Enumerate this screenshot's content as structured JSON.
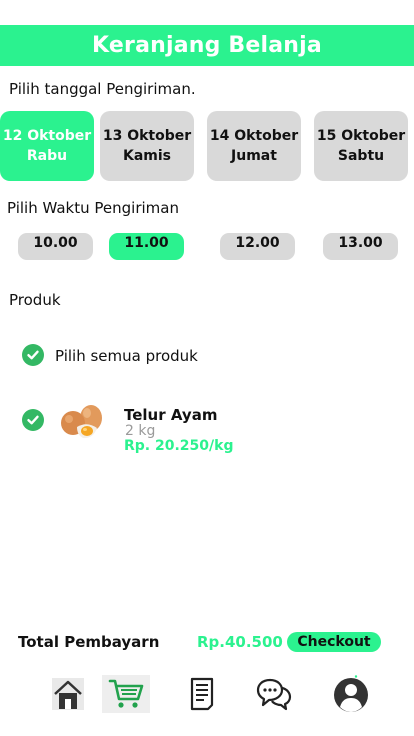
{
  "header": {
    "title": "Keranjang Belanja"
  },
  "date_section": {
    "label": "Pilih tanggal Pengiriman.",
    "dates": [
      {
        "day": "12 Oktober",
        "weekday": "Rabu",
        "selected": true
      },
      {
        "day": "13 Oktober",
        "weekday": "Kamis",
        "selected": false
      },
      {
        "day": "14 Oktober",
        "weekday": "Jumat",
        "selected": false
      },
      {
        "day": "15 Oktober",
        "weekday": "Sabtu",
        "selected": false
      }
    ]
  },
  "time_section": {
    "label": "Pilih Waktu Pengiriman",
    "times": [
      {
        "value": "10.00",
        "selected": false
      },
      {
        "value": "11.00",
        "selected": true
      },
      {
        "value": "12.00",
        "selected": false
      },
      {
        "value": "13.00",
        "selected": false
      }
    ]
  },
  "product_section": {
    "label": "Produk",
    "select_all_label": "Pilih semua produk",
    "items": [
      {
        "name": "Telur Ayam",
        "weight": "2 kg",
        "price": "Rp. 20.250/kg",
        "checked": true
      }
    ]
  },
  "summary": {
    "total_label": "Total Pembayarn",
    "total_value": "Rp.40.500",
    "checkout_label": "Checkout"
  },
  "bottom_nav": [
    {
      "icon": "home-icon",
      "active": false
    },
    {
      "icon": "cart-icon",
      "active": true
    },
    {
      "icon": "order-list-icon",
      "active": false
    },
    {
      "icon": "chat-icon",
      "active": false
    },
    {
      "icon": "profile-icon",
      "active": false
    }
  ],
  "colors": {
    "accent": "#2bf28f",
    "check": "#33b864",
    "chip": "#d9d9d9"
  }
}
